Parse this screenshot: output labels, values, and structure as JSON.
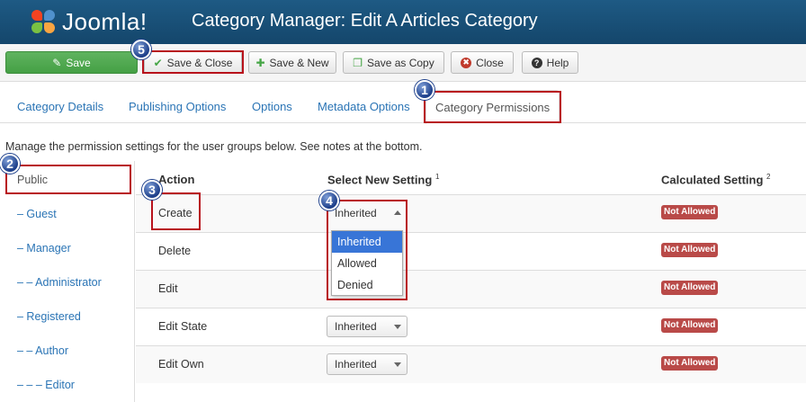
{
  "header": {
    "logo_text": "Joomla!",
    "title": "Category Manager: Edit A Articles Category"
  },
  "toolbar": {
    "save": "Save",
    "save_close": "Save & Close",
    "save_new": "Save & New",
    "save_copy": "Save as Copy",
    "close": "Close",
    "help": "Help"
  },
  "tabs": [
    {
      "label": "Category Details"
    },
    {
      "label": "Publishing Options"
    },
    {
      "label": "Options"
    },
    {
      "label": "Metadata Options"
    },
    {
      "label": "Category Permissions",
      "active": true
    }
  ],
  "intro": "Manage the permission settings for the user groups below. See notes at the bottom.",
  "groups": [
    {
      "label": "Public"
    },
    {
      "label": "– Guest"
    },
    {
      "label": "– Manager"
    },
    {
      "label": "– – Administrator"
    },
    {
      "label": "– Registered"
    },
    {
      "label": "– – Author"
    },
    {
      "label": "– – – Editor"
    }
  ],
  "table": {
    "headers": {
      "action": "Action",
      "setting": "Select New Setting",
      "setting_note": "1",
      "calculated": "Calculated Setting",
      "calculated_note": "2"
    },
    "rows": [
      {
        "action": "Create",
        "setting": "Inherited",
        "calculated": "Not Allowed"
      },
      {
        "action": "Delete",
        "setting": "Inherited",
        "calculated": "Not Allowed"
      },
      {
        "action": "Edit",
        "setting": "Inherited",
        "calculated": "Not Allowed"
      },
      {
        "action": "Edit State",
        "setting": "Inherited",
        "calculated": "Not Allowed"
      },
      {
        "action": "Edit Own",
        "setting": "Inherited",
        "calculated": "Not Allowed"
      }
    ]
  },
  "dropdown_options": [
    "Inherited",
    "Allowed",
    "Denied"
  ],
  "markers": [
    "1",
    "2",
    "3",
    "4",
    "5"
  ],
  "colors": {
    "header_bg": "#1a5079",
    "save_green": "#51a851",
    "link_blue": "#2a74b5",
    "badge_red": "#b94a48",
    "annotation_red": "#b8121b"
  }
}
